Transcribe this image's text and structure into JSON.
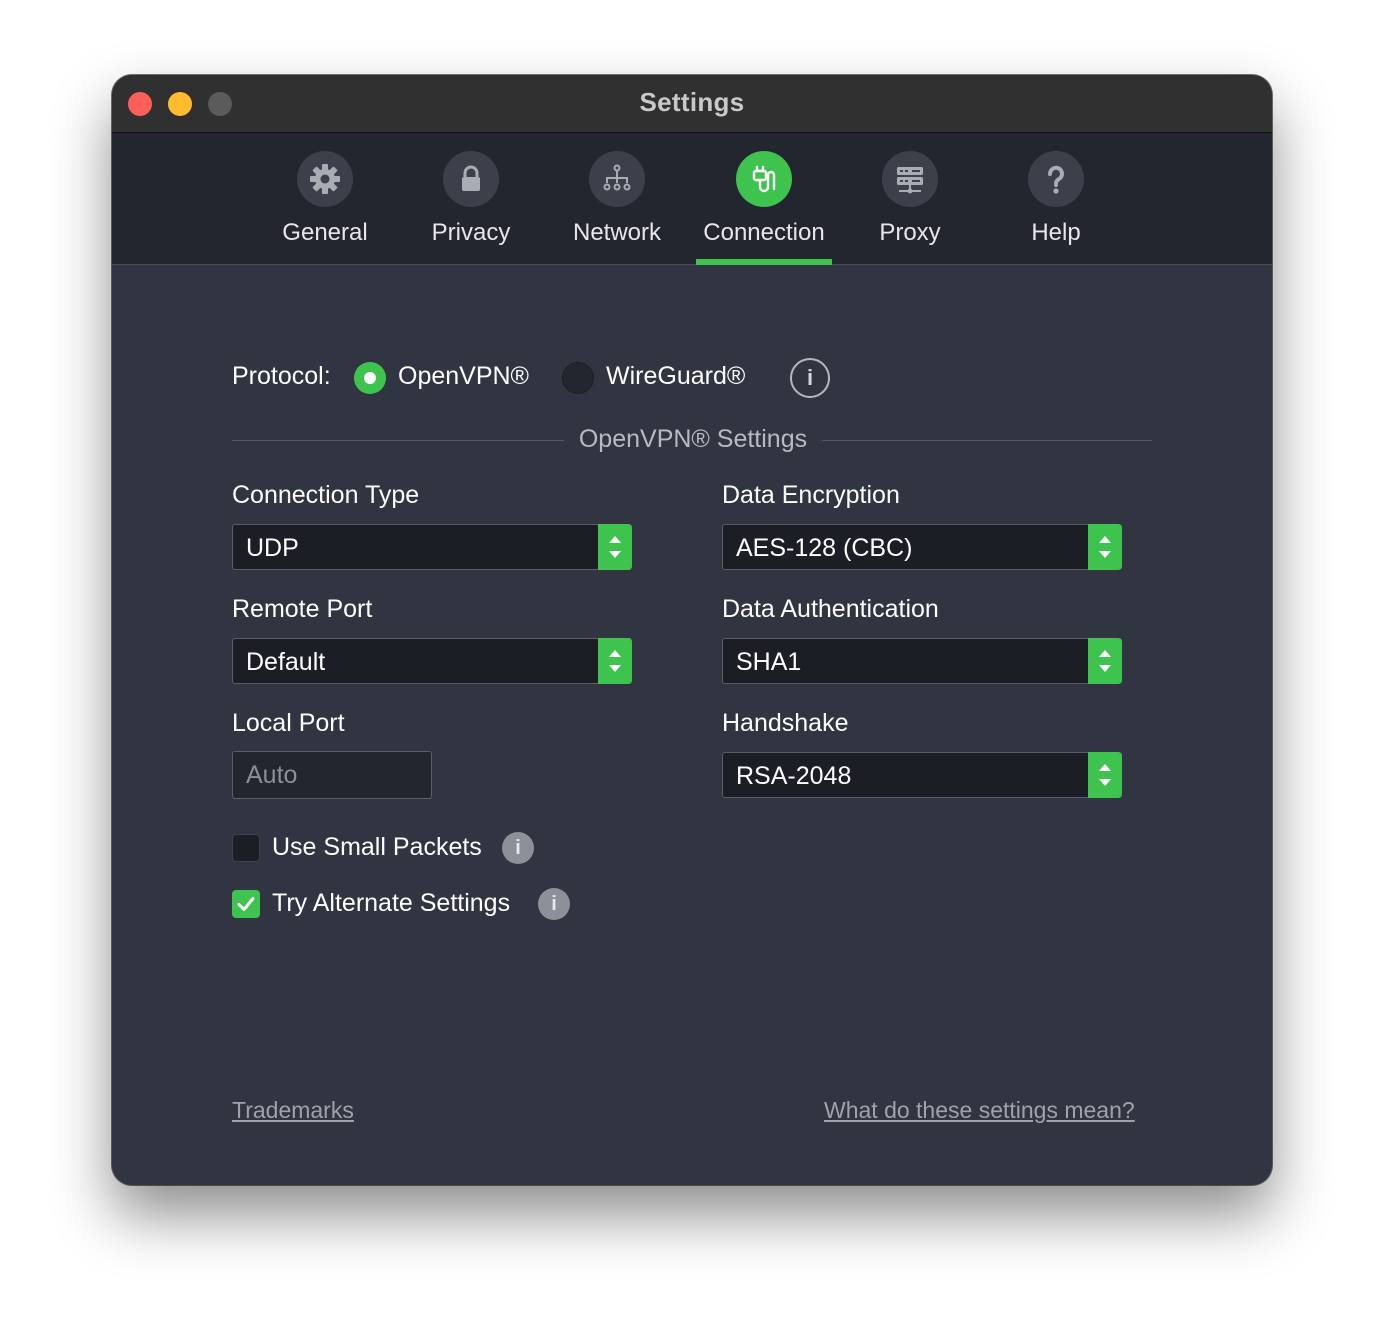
{
  "window": {
    "title": "Settings"
  },
  "tabs": [
    {
      "label": "General",
      "icon": "gear-icon"
    },
    {
      "label": "Privacy",
      "icon": "lock-icon"
    },
    {
      "label": "Network",
      "icon": "network-icon"
    },
    {
      "label": "Connection",
      "icon": "plug-icon",
      "active": true
    },
    {
      "label": "Proxy",
      "icon": "server-icon"
    },
    {
      "label": "Help",
      "icon": "question-icon"
    }
  ],
  "protocol": {
    "label": "Protocol:",
    "options": [
      "OpenVPN®",
      "WireGuard®"
    ],
    "selected": "OpenVPN®",
    "info": "i"
  },
  "section_title": "OpenVPN® Settings",
  "fields": {
    "connection_type": {
      "label": "Connection Type",
      "value": "UDP"
    },
    "remote_port": {
      "label": "Remote Port",
      "value": "Default"
    },
    "local_port": {
      "label": "Local Port",
      "placeholder": "Auto"
    },
    "data_encryption": {
      "label": "Data Encryption",
      "value": "AES-128 (CBC)"
    },
    "data_authentication": {
      "label": "Data Authentication",
      "value": "SHA1"
    },
    "handshake": {
      "label": "Handshake",
      "value": "RSA-2048"
    }
  },
  "options": {
    "small_packets": {
      "label": "Use Small Packets",
      "checked": false
    },
    "alternate_settings": {
      "label": "Try Alternate Settings",
      "checked": true
    }
  },
  "links": {
    "trademarks": "Trademarks",
    "help": "What do these settings mean?"
  },
  "colors": {
    "accent": "#3ec44e",
    "background": "#313542",
    "toolbar": "#23262f"
  }
}
